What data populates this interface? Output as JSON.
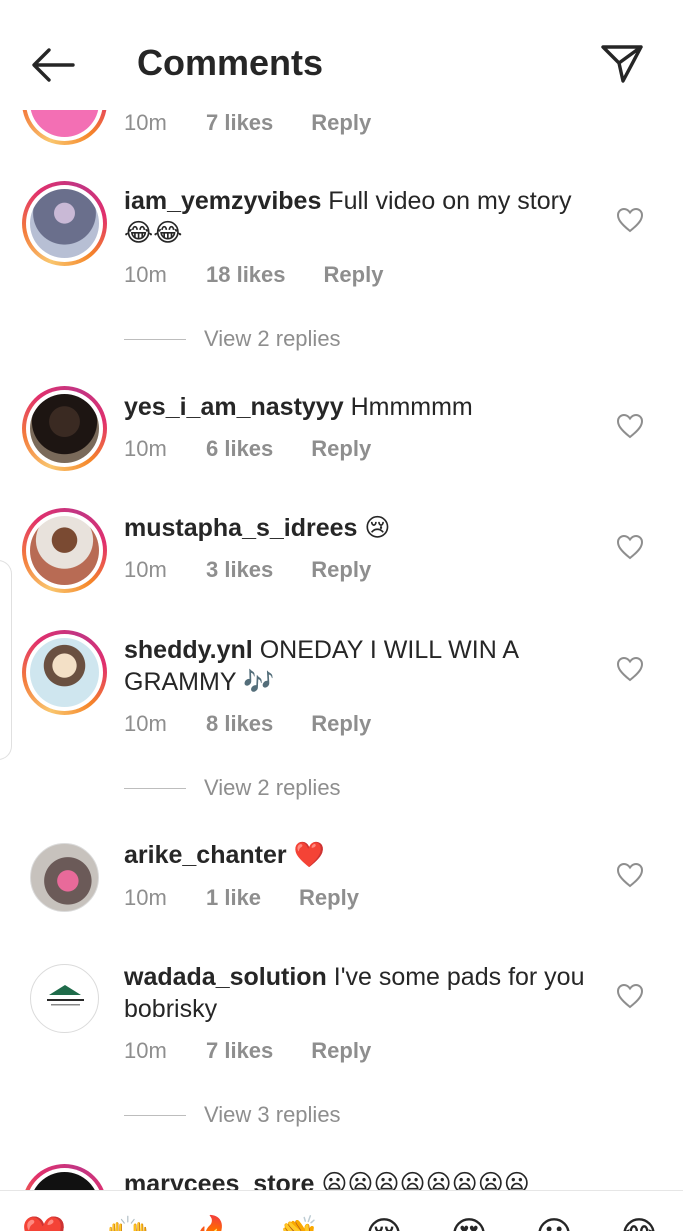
{
  "header": {
    "title": "Comments",
    "back_icon": "arrow-left-icon",
    "send_icon": "paper-plane-icon"
  },
  "comments": [
    {
      "username": "",
      "text": "",
      "time": "10m",
      "likes": "7 likes",
      "reply": "Reply"
    },
    {
      "username": "iam_yemzyvibes",
      "text": " Full video on my story",
      "emoji": "😂😂",
      "time": "10m",
      "likes": "18 likes",
      "reply": "Reply",
      "view_replies": "View 2 replies"
    },
    {
      "username": "yes_i_am_nastyyy",
      "text": " Hmmmmm",
      "time": "10m",
      "likes": "6 likes",
      "reply": "Reply"
    },
    {
      "username": "mustapha_s_idrees",
      "text": " ",
      "emoji": "😢",
      "time": "10m",
      "likes": "3 likes",
      "reply": "Reply"
    },
    {
      "username": "sheddy.ynl",
      "text": " ONEDAY I WILL WIN A GRAMMY ",
      "emoji": "🎶",
      "time": "10m",
      "likes": "8 likes",
      "reply": "Reply",
      "view_replies": "View 2 replies"
    },
    {
      "username": "arike_chanter",
      "text": " ",
      "emoji": "❤️",
      "time": "10m",
      "likes": "1 like",
      "reply": "Reply"
    },
    {
      "username": "wadada_solution",
      "text": " I've some pads for you bobrisky",
      "time": "10m",
      "likes": "7 likes",
      "reply": "Reply",
      "view_replies": "View 3 replies"
    },
    {
      "username": "marycees_store",
      "text": " ",
      "emoji": "😦😦😦😦😦😦😦😦"
    }
  ],
  "emoji_bar": [
    "❤️",
    "🙌",
    "🔥",
    "👏",
    "😢",
    "😍",
    "😮",
    "😂"
  ]
}
